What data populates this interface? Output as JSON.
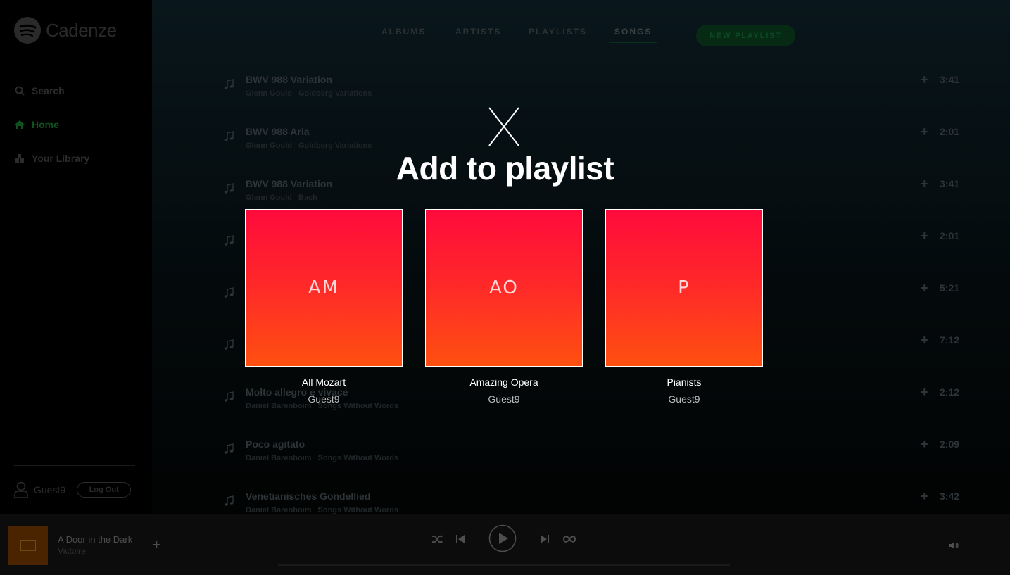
{
  "app": {
    "name": "Cadenze"
  },
  "sidebar": {
    "items": [
      {
        "label": "Search",
        "icon": "search-icon"
      },
      {
        "label": "Home",
        "icon": "home-icon",
        "active": true
      },
      {
        "label": "Your Library",
        "icon": "library-icon"
      }
    ],
    "user": {
      "name": "Guest9",
      "logout_label": "Log Out"
    }
  },
  "tabs": [
    {
      "label": "ALBUMS"
    },
    {
      "label": "ARTISTS"
    },
    {
      "label": "PLAYLISTS"
    },
    {
      "label": "SONGS",
      "active": true
    }
  ],
  "new_playlist_label": "NEW PLAYLIST",
  "songs": [
    {
      "title": "BWV 988 Variation",
      "artist": "Glenn Gould",
      "album": "Goldberg Variations",
      "duration": "3:41"
    },
    {
      "title": "BWV 988 Aria",
      "artist": "Glenn Gould",
      "album": "Goldberg Variations",
      "duration": "2:01"
    },
    {
      "title": "BWV 988 Variation",
      "artist": "Glenn Gould",
      "album": "Bach",
      "duration": "3:41"
    },
    {
      "title": "",
      "artist": "",
      "album": "",
      "duration": "2:01"
    },
    {
      "title": "",
      "artist": "",
      "album": "",
      "duration": "5:21"
    },
    {
      "title": "",
      "artist": "",
      "album": "",
      "duration": "7:12"
    },
    {
      "title": "Molto allegro e vivace",
      "artist": "Daniel Barenboim",
      "album": "Songs Without Words",
      "duration": "2:12"
    },
    {
      "title": "Poco agitato",
      "artist": "Daniel Barenboim",
      "album": "Songs Without Words",
      "duration": "2:09"
    },
    {
      "title": "Venetianisches Gondellied",
      "artist": "Daniel Barenboim",
      "album": "Songs Without Words",
      "duration": "3:42"
    }
  ],
  "player": {
    "title": "A Door in the Dark",
    "artist": "Victoire",
    "add_symbol": "+"
  },
  "modal": {
    "title": "Add to playlist",
    "playlists": [
      {
        "initials": "AM",
        "name": "All Mozart",
        "owner": "Guest9"
      },
      {
        "initials": "AO",
        "name": "Amazing Opera",
        "owner": "Guest9"
      },
      {
        "initials": "P",
        "name": "Pianists",
        "owner": "Guest9"
      }
    ]
  },
  "colors": {
    "accent_green": "#1db954",
    "playlist_gradient_top": "#ff0a3c",
    "playlist_gradient_bottom": "#ff5010"
  }
}
